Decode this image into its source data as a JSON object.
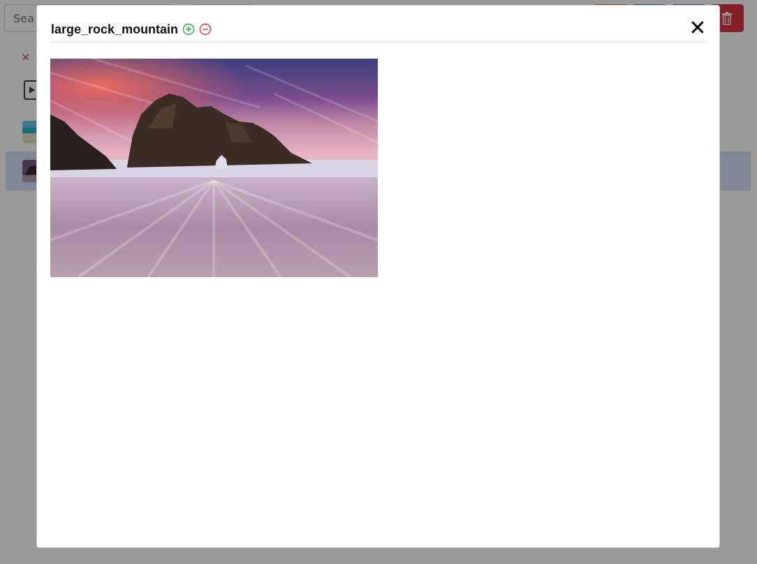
{
  "background": {
    "search_placeholder": "Sea",
    "clear_icon": "×"
  },
  "modal": {
    "title": "large_rock_mountain",
    "close_symbol": "✕",
    "zoom_in_icon": "zoom-in-circle-icon",
    "zoom_out_icon": "zoom-out-circle-icon",
    "image_subject": "rock arch on beach at sunset"
  },
  "colors": {
    "zoom_in": "#28a745",
    "zoom_out": "#dc3545",
    "selected_row": "#cfe0f7",
    "delete_button": "#dc3545"
  }
}
